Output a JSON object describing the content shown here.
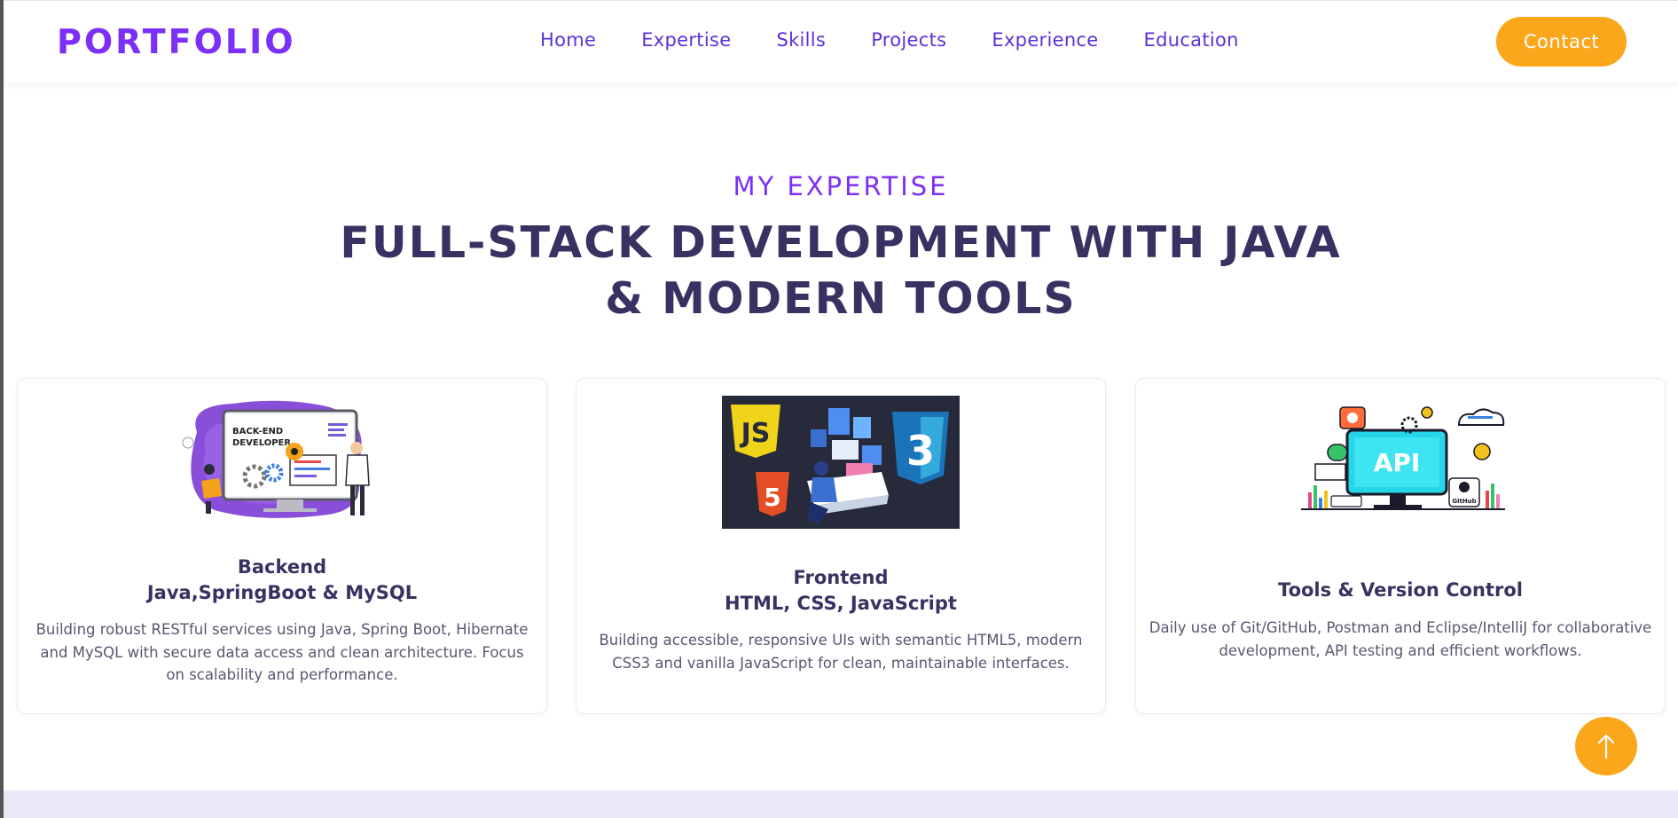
{
  "nav": {
    "brand": "PORTFOLIO",
    "links": [
      "Home",
      "Expertise",
      "Skills",
      "Projects",
      "Experience",
      "Education"
    ],
    "contact": "Contact"
  },
  "expertise": {
    "subtitle": "MY EXPERTISE",
    "title_line1": "FULL-STACK DEVELOPMENT WITH JAVA",
    "title_line2": "& MODERN TOOLS",
    "cards": [
      {
        "title_line1": "Backend",
        "title_line2": "Java,SpringBoot & MySQL",
        "desc": "Building robust RESTful services using Java, Spring Boot, Hibernate and MySQL with secure data access and clean architecture. Focus on scalability and performance.",
        "image_text1": "BACK-END",
        "image_text2": "DEVELOPER"
      },
      {
        "title_line1": "Frontend",
        "title_line2": "HTML, CSS, JavaScript",
        "desc": "Building accessible, responsive UIs with semantic HTML5, modern CSS3 and vanilla JavaScript for clean, maintainable interfaces.",
        "image_text1": "JS",
        "image_text2": "5",
        "image_text3": "3"
      },
      {
        "title_line1": "Tools & Version Control",
        "desc": "Daily use of Git/GitHub, Postman and Eclipse/IntelliJ for collaborative development, API testing and efficient workflows.",
        "image_text1": "API",
        "image_text2": "GitHub"
      }
    ]
  },
  "colors": {
    "accent_purple": "#7b2ff7",
    "heading": "#3a3062",
    "orange": "#fba71b"
  }
}
